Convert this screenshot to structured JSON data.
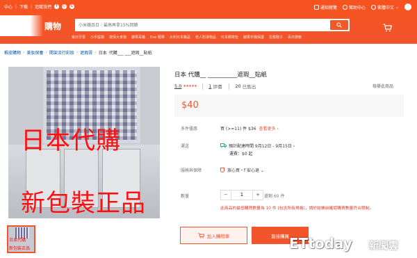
{
  "colors": {
    "brand": "#f2552c",
    "warning": "#e4392a",
    "link": "#0055aa"
  },
  "topbar": {
    "left_items": [
      "中心",
      "下載",
      "追蹤我們"
    ],
    "right_items": [
      "通知總覽",
      "幫助中心",
      "繁體中文"
    ]
  },
  "header": {
    "logo_text": "購物",
    "search_placeholder": "小米鏡品日｜最高再拿15%回饋",
    "hotwords": [
      "東日牙膏",
      "小手提袋",
      "環保大食物",
      "蘋果耳機",
      "Eve 輕單",
      "大利日本藥品",
      "老人防滑物品",
      "日本郵寄包",
      "蘋果手機保護",
      "任我鞋子",
      "百日搜索"
    ]
  },
  "breadcrumb": {
    "items": [
      "蝦皮購物",
      "美妝保養",
      "開架流行彩妝",
      "遮瑕膏",
      "日本"
    ],
    "current": "代購___  ___遮瑕__貼紙"
  },
  "product": {
    "image_text_1": "日本代購",
    "image_text_2": "新包裝正品",
    "title": "日本      代購__      __________遮瑕__貼紙",
    "rating": "5.0",
    "stars": "★★★★★",
    "review_count": "1",
    "review_label": "評價",
    "sold_count": "20",
    "sold_label": "已售出",
    "report": "檢舉此商品",
    "price": "$40"
  },
  "details": {
    "promo_label": "多件優惠",
    "promo_text": "買 (>=11) 件 $36",
    "promo_more": "查看更多 ›",
    "shipping_label": "運送",
    "shipping_eta": "預計配達時間 9月12日 - 9月15日 ›",
    "shipping_fee": "運費：$0 起",
    "service_label": "服務與保障",
    "service_text": "放心買・f      安心退 ⌄",
    "qty_label": "數量",
    "qty_minus": "−",
    "qty_value": "1",
    "qty_plus": "+",
    "stock": "還剩 60 件",
    "warning": "此商品的最低購買數量為 10 件 (包含所有規格)，請於結帳前確認購買數量符合限制。"
  },
  "actions": {
    "add_to_cart": "加入購物車",
    "buy_now": "直接購買"
  },
  "watermark": {
    "brand": "ETtoday",
    "suffix": "新聞雲"
  }
}
